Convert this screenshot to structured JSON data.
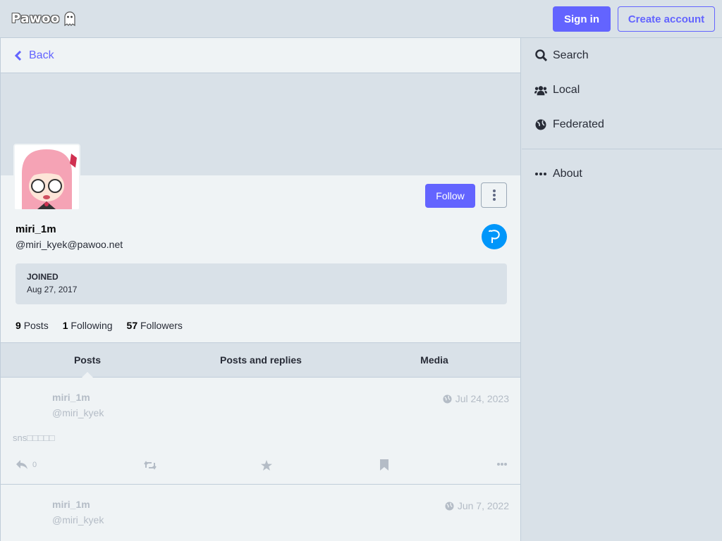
{
  "topbar": {
    "logo_text": "Pawoo",
    "signin_label": "Sign in",
    "create_label": "Create account"
  },
  "back": {
    "label": "Back"
  },
  "profile": {
    "display_name": "miri_1m",
    "acct": "@miri_kyek@pawoo.net",
    "follow_label": "Follow",
    "joined_label": "JOINED",
    "joined_date": "Aug 27, 2017",
    "counts": [
      {
        "value": "9",
        "label": "Posts"
      },
      {
        "value": "1",
        "label": "Following"
      },
      {
        "value": "57",
        "label": "Followers"
      }
    ]
  },
  "tabs": [
    {
      "label": "Posts",
      "active": true
    },
    {
      "label": "Posts and replies",
      "active": false
    },
    {
      "label": "Media",
      "active": false
    }
  ],
  "statuses": [
    {
      "name": "miri_1m",
      "acct": "@miri_kyek",
      "time": "Jul 24, 2023",
      "content": "sns\u0000\u0000\u0000\u0000\u0000",
      "replies": "0"
    },
    {
      "name": "miri_1m",
      "acct": "@miri_kyek",
      "time": "Jun 7, 2022",
      "content": "",
      "replies": ""
    }
  ],
  "sidebar": {
    "items": [
      {
        "label": "Search",
        "icon": "search-icon"
      },
      {
        "label": "Local",
        "icon": "users-icon"
      },
      {
        "label": "Federated",
        "icon": "globe-icon"
      }
    ],
    "about_label": "About"
  },
  "colors": {
    "accent": "#6364ff",
    "bg": "#d9e1e8",
    "panel": "#eff3f5",
    "pixiv": "#0096fa"
  }
}
